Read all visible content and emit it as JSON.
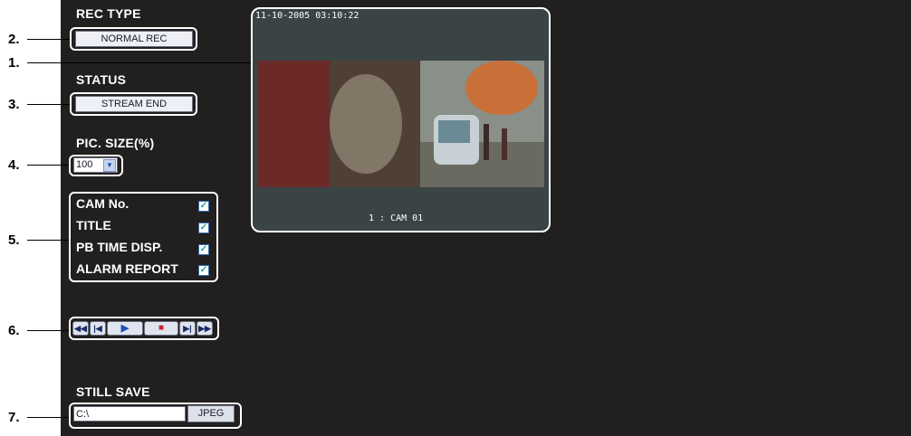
{
  "callouts": [
    "1.",
    "2.",
    "3.",
    "4.",
    "5.",
    "6.",
    "7."
  ],
  "rec_type": {
    "label": "REC TYPE",
    "value": "NORMAL REC"
  },
  "status": {
    "label": "STATUS",
    "value": "STREAM END"
  },
  "pic_size": {
    "label": "PIC. SIZE(%)",
    "value": "100"
  },
  "display_options": [
    {
      "label": "CAM No.",
      "checked": true
    },
    {
      "label": "TITLE",
      "checked": true
    },
    {
      "label": "PB TIME DISP.",
      "checked": true
    },
    {
      "label": "ALARM REPORT",
      "checked": true
    }
  ],
  "playback_controls": [
    "fast-rewind-icon",
    "step-back-icon",
    "play-icon",
    "stop-icon",
    "step-forward-icon",
    "fast-forward-icon"
  ],
  "still_save": {
    "label": "STILL SAVE",
    "path_value": "C:\\",
    "button_label": "JPEG"
  },
  "video": {
    "timestamp": "11-10-2005 03:10:22",
    "camera_label": "1 : CAM 01"
  },
  "colors": {
    "panel": "#221f1f",
    "check": "#19a3a3",
    "play": "#1e4fb8",
    "stop": "#d0203a"
  }
}
